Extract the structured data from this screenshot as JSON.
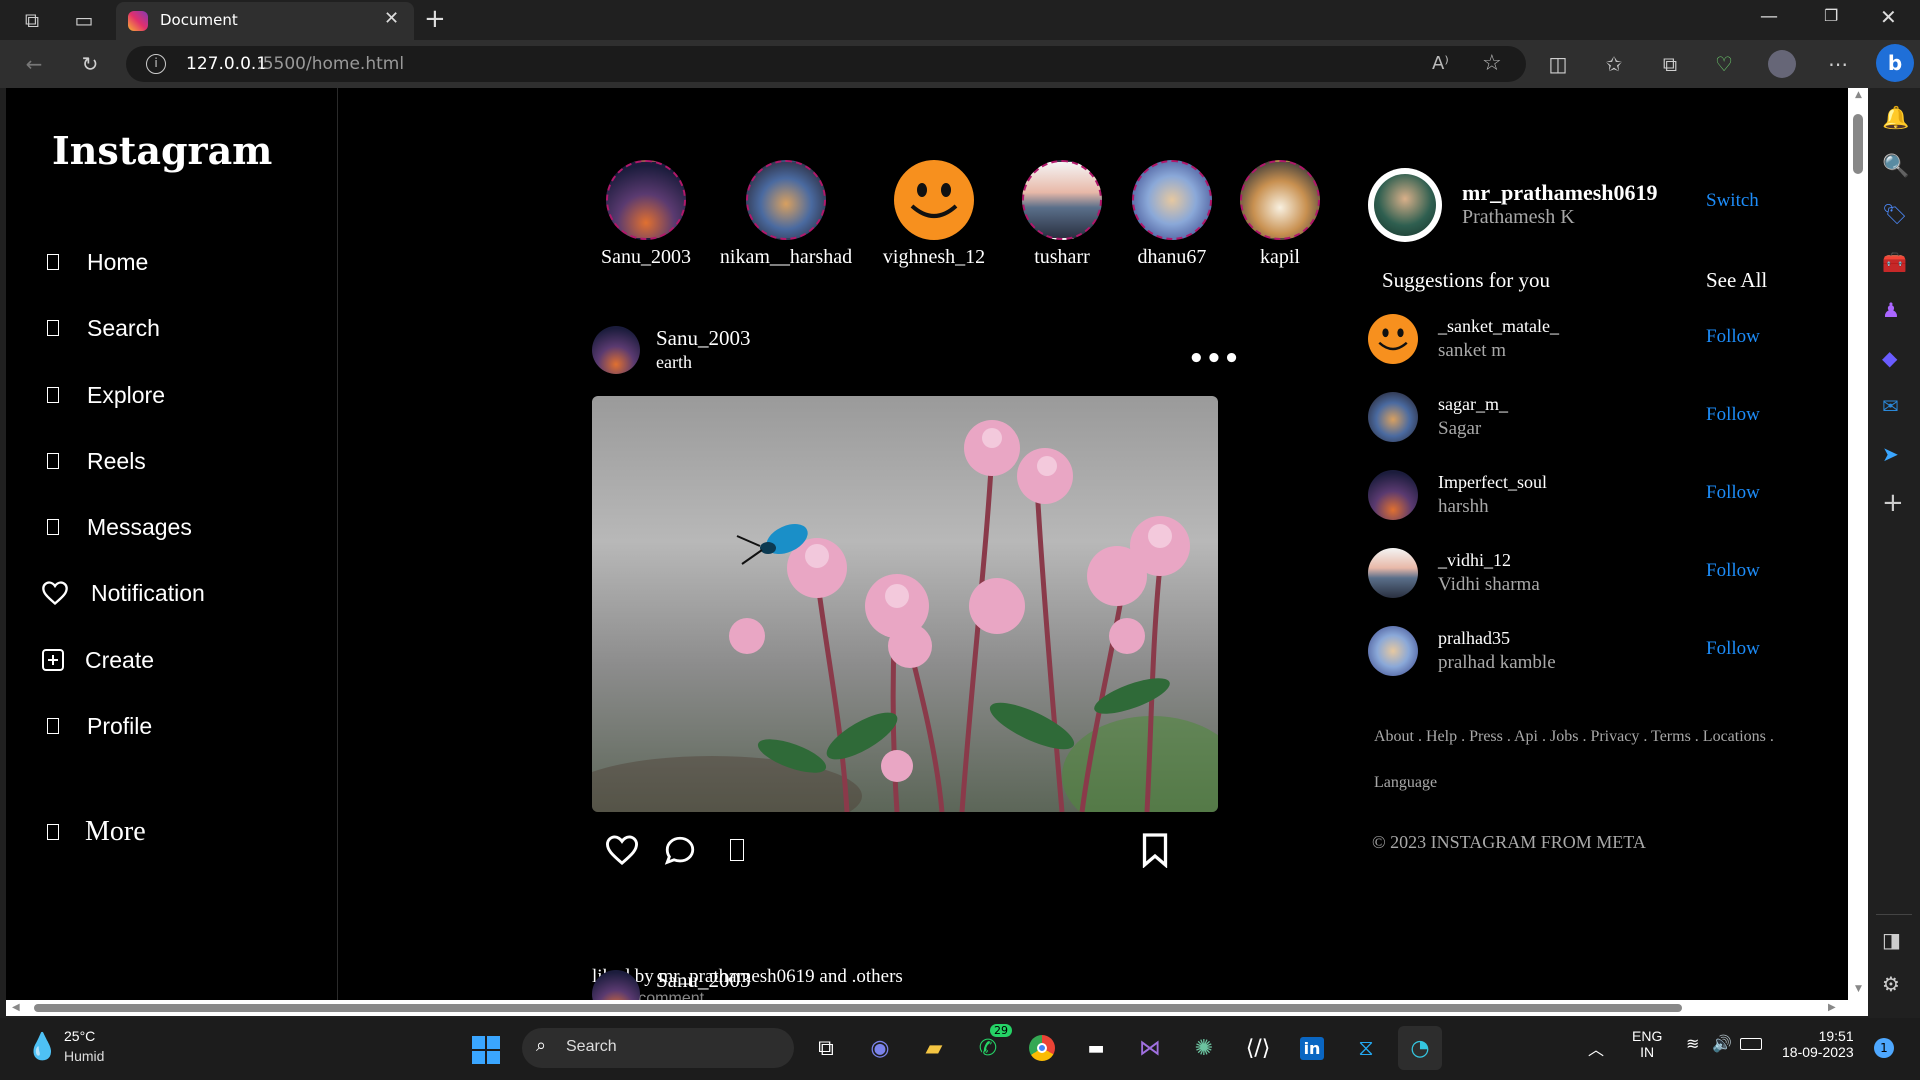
{
  "browser": {
    "tab_title": "Document",
    "url_host": "127.0.0.1",
    "url_path": ":5500/home.html",
    "read_aloud": "A⁾"
  },
  "app": {
    "logo": "Instagram",
    "nav": [
      {
        "label": "Home"
      },
      {
        "label": "Search"
      },
      {
        "label": "Explore"
      },
      {
        "label": "Reels"
      },
      {
        "label": "Messages"
      },
      {
        "label": "Notification"
      },
      {
        "label": "Create"
      },
      {
        "label": "Profile"
      },
      {
        "label": "More"
      }
    ],
    "stories": [
      {
        "name": "Sanu_2003"
      },
      {
        "name": "nikam__harshad"
      },
      {
        "name": "vighnesh_12"
      },
      {
        "name": "tusharr"
      },
      {
        "name": "dhanu67"
      },
      {
        "name": "kapil"
      }
    ],
    "post": {
      "username": "Sanu_2003",
      "location": "earth",
      "liked_by": "liked by mr_prathamesh0619 and .others",
      "comment_placeholder": "Add a comment...",
      "next_username": "Sanu_2003"
    },
    "profile": {
      "username": "mr_prathamesh0619",
      "fullname": "Prathamesh K",
      "switch_label": "Switch"
    },
    "suggestions_title": "Suggestions for you",
    "see_all": "See All",
    "suggestions": [
      {
        "username": "_sanket_matale_",
        "name": "sanket m",
        "action": "Follow"
      },
      {
        "username": "sagar_m_",
        "name": "Sagar",
        "action": "Follow"
      },
      {
        "username": "Imperfect_soul",
        "name": "harshh",
        "action": "Follow"
      },
      {
        "username": "_vidhi_12",
        "name": "Vidhi sharma",
        "action": "Follow"
      },
      {
        "username": "pralhad35",
        "name": "pralhad kamble",
        "action": "Follow"
      }
    ],
    "footer_links": "About . Help . Press . Api . Jobs . Privacy . Terms . Locations .",
    "footer_language": "Language",
    "copyright": "© 2023 INSTAGRAM FROM META"
  },
  "taskbar": {
    "weather_temp": "25°C",
    "weather_desc": "Humid",
    "search_label": "Search",
    "whatsapp_badge": "29",
    "lang": "ENG",
    "region": "IN",
    "time": "19:51",
    "date": "18-09-2023",
    "notif_count": "1"
  }
}
